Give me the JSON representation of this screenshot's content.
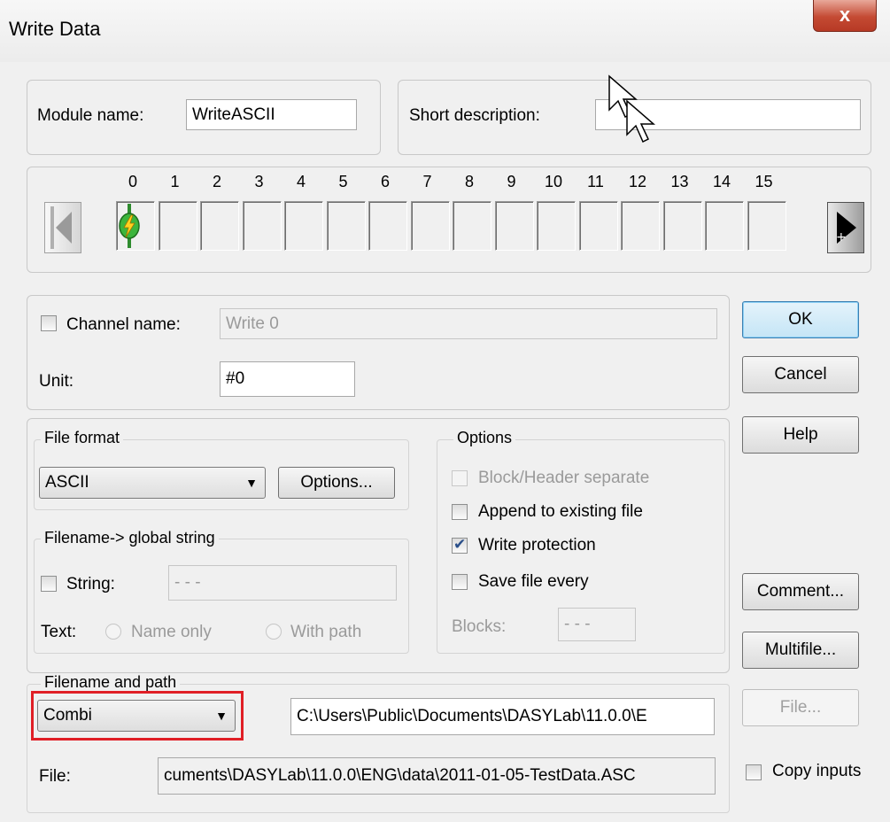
{
  "window": {
    "title": "Write Data",
    "close_label": "x"
  },
  "module": {
    "name_label": "Module name:",
    "name_value": "WriteASCII",
    "desc_label": "Short description:",
    "desc_value": ""
  },
  "channels": {
    "numbers": [
      "0",
      "1",
      "2",
      "3",
      "4",
      "5",
      "6",
      "7",
      "8",
      "9",
      "10",
      "11",
      "12",
      "13",
      "14",
      "15"
    ],
    "active_index": 0
  },
  "channel": {
    "name_label": "Channel name:",
    "name_value": "Write 0",
    "unit_label": "Unit:",
    "unit_value": "#0"
  },
  "buttons": {
    "ok": "OK",
    "cancel": "Cancel",
    "help": "Help",
    "comment": "Comment...",
    "multifile": "Multifile...",
    "file": "File...",
    "format_options": "Options..."
  },
  "file_format": {
    "legend": "File format",
    "selected": "ASCII"
  },
  "global_string": {
    "legend": "Filename-> global string",
    "string_label": "String:",
    "string_value": "- - -",
    "text_label": "Text:",
    "name_only": "Name only",
    "with_path": "With path"
  },
  "options": {
    "legend": "Options",
    "block_header": "Block/Header separate",
    "append": "Append to existing file",
    "write_protection": "Write protection",
    "save_every": "Save file every",
    "blocks_label": "Blocks:",
    "blocks_value": "- - -"
  },
  "path": {
    "legend": "Filename and path",
    "mode": "Combi",
    "dir_value": "C:\\Users\\Public\\Documents\\DASYLab\\11.0.0\\E",
    "file_label": "File:",
    "file_value": "cuments\\DASYLab\\11.0.0\\ENG\\data\\2011-01-05-TestData.ASC",
    "copy_inputs": "Copy inputs"
  }
}
